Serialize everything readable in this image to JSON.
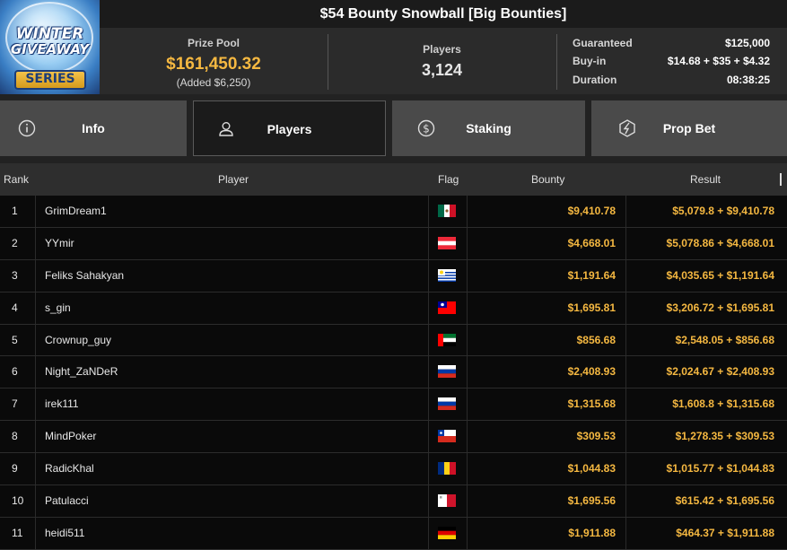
{
  "header": {
    "logo": {
      "line1": "WINTER",
      "line2": "GIVEAWAY",
      "line3": "SERIES"
    },
    "title": "$54 Bounty Snowball [Big Bounties]",
    "prize_pool": {
      "label": "Prize Pool",
      "value": "$161,450.32",
      "added": "(Added $6,250)"
    },
    "players": {
      "label": "Players",
      "value": "3,124"
    },
    "details": [
      {
        "key": "Guaranteed",
        "value": "$125,000"
      },
      {
        "key": "Buy-in",
        "value": "$14.68 + $35 + $4.32"
      },
      {
        "key": "Duration",
        "value": "08:38:25"
      }
    ]
  },
  "tabs": [
    {
      "label": "Info",
      "icon": "info-icon",
      "active": false
    },
    {
      "label": "Players",
      "icon": "user-icon",
      "active": true
    },
    {
      "label": "Staking",
      "icon": "coin-dollar-icon",
      "active": false
    },
    {
      "label": "Prop Bet",
      "icon": "lightning-hexagon-icon",
      "active": false
    }
  ],
  "table": {
    "columns": [
      "Rank",
      "Player",
      "Flag",
      "Bounty",
      "Result"
    ],
    "rows": [
      {
        "rank": "1",
        "player": "GrimDream1",
        "flag": "mexico-flag",
        "bounty": "$9,410.78",
        "result": "$5,079.8 + $9,410.78"
      },
      {
        "rank": "2",
        "player": "YYmir",
        "flag": "austria-flag",
        "bounty": "$4,668.01",
        "result": "$5,078.86 + $4,668.01"
      },
      {
        "rank": "3",
        "player": "Feliks Sahakyan",
        "flag": "uruguay-flag",
        "bounty": "$1,191.64",
        "result": "$4,035.65 + $1,191.64"
      },
      {
        "rank": "4",
        "player": "s_gin",
        "flag": "taiwan-flag",
        "bounty": "$1,695.81",
        "result": "$3,206.72 + $1,695.81"
      },
      {
        "rank": "5",
        "player": "Crownup_guy",
        "flag": "uae-flag",
        "bounty": "$856.68",
        "result": "$2,548.05 + $856.68"
      },
      {
        "rank": "6",
        "player": "Night_ZaNDeR",
        "flag": "russia-flag",
        "bounty": "$2,408.93",
        "result": "$2,024.67 + $2,408.93"
      },
      {
        "rank": "7",
        "player": "irek111",
        "flag": "russia-flag",
        "bounty": "$1,315.68",
        "result": "$1,608.8 + $1,315.68"
      },
      {
        "rank": "8",
        "player": "MindPoker",
        "flag": "chile-flag",
        "bounty": "$309.53",
        "result": "$1,278.35 + $309.53"
      },
      {
        "rank": "9",
        "player": "RadicKhal",
        "flag": "romania-flag",
        "bounty": "$1,044.83",
        "result": "$1,015.77 + $1,044.83"
      },
      {
        "rank": "10",
        "player": "Patulacci",
        "flag": "malta-flag",
        "bounty": "$1,695.56",
        "result": "$615.42 + $1,695.56"
      },
      {
        "rank": "11",
        "player": "heidi511",
        "flag": "germany-flag",
        "bounty": "$1,911.88",
        "result": "$464.37 + $1,911.88"
      }
    ]
  },
  "colors": {
    "accent": "#f5b841",
    "background": "#0a0a0a",
    "header": "#2b2b2b"
  }
}
